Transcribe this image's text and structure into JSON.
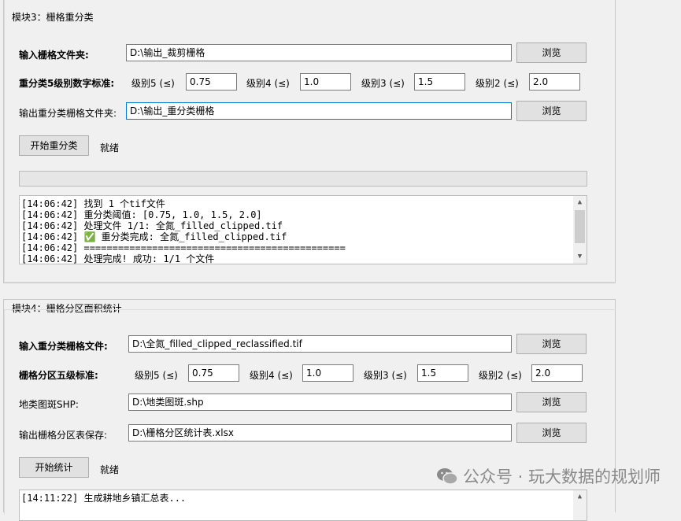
{
  "module3": {
    "title": "模块3：栅格重分类",
    "input_label": "输入栅格文件夹:",
    "input_value": "D:\\输出_裁剪栅格",
    "browse1": "浏览",
    "standard_label": "重分类5级别数字标准:",
    "levels": [
      {
        "label": "级别5 (≤)",
        "value": "0.75"
      },
      {
        "label": "级别4 (≤)",
        "value": "1.0"
      },
      {
        "label": "级别3 (≤)",
        "value": "1.5"
      },
      {
        "label": "级别2 (≤)",
        "value": "2.0"
      }
    ],
    "output_label": "输出重分类栅格文件夹:",
    "output_value": "D:\\输出_重分类栅格",
    "browse2": "浏览",
    "start_button": "开始重分类",
    "status": "就绪",
    "progress": 0,
    "log": [
      "[14:06:42] 找到 1 个tif文件",
      "[14:06:42] 重分类阈值: [0.75, 1.0, 1.5, 2.0]",
      "[14:06:42] 处理文件 1/1: 全氮_filled_clipped.tif",
      "[14:06:42] ✅ 重分类完成: 全氮_filled_clipped.tif",
      "[14:06:42] ==============================================",
      "[14:06:42] 处理完成! 成功: 1/1 个文件"
    ]
  },
  "module4": {
    "title": "模块4：栅格分区面积统计",
    "input_label": "输入重分类栅格文件:",
    "input_value": "D:\\全氮_filled_clipped_reclassified.tif",
    "browse1": "浏览",
    "standard_label": "栅格分区五级标准:",
    "levels": [
      {
        "label": "级别5 (≤)",
        "value": "0.75"
      },
      {
        "label": "级别4 (≤)",
        "value": "1.0"
      },
      {
        "label": "级别3 (≤)",
        "value": "1.5"
      },
      {
        "label": "级别2 (≤)",
        "value": "2.0"
      }
    ],
    "shp_label": "地类图斑SHP:",
    "shp_value": "D:\\地类图斑.shp",
    "browse2": "浏览",
    "output_label": "输出栅格分区表保存:",
    "output_value": "D:\\栅格分区统计表.xlsx",
    "browse3": "浏览",
    "start_button": "开始统计",
    "status": "就绪",
    "log": [
      "[14:11:22] 生成耕地乡镇汇总表..."
    ]
  },
  "watermark": "公众号 · 玩大数据的规划师"
}
